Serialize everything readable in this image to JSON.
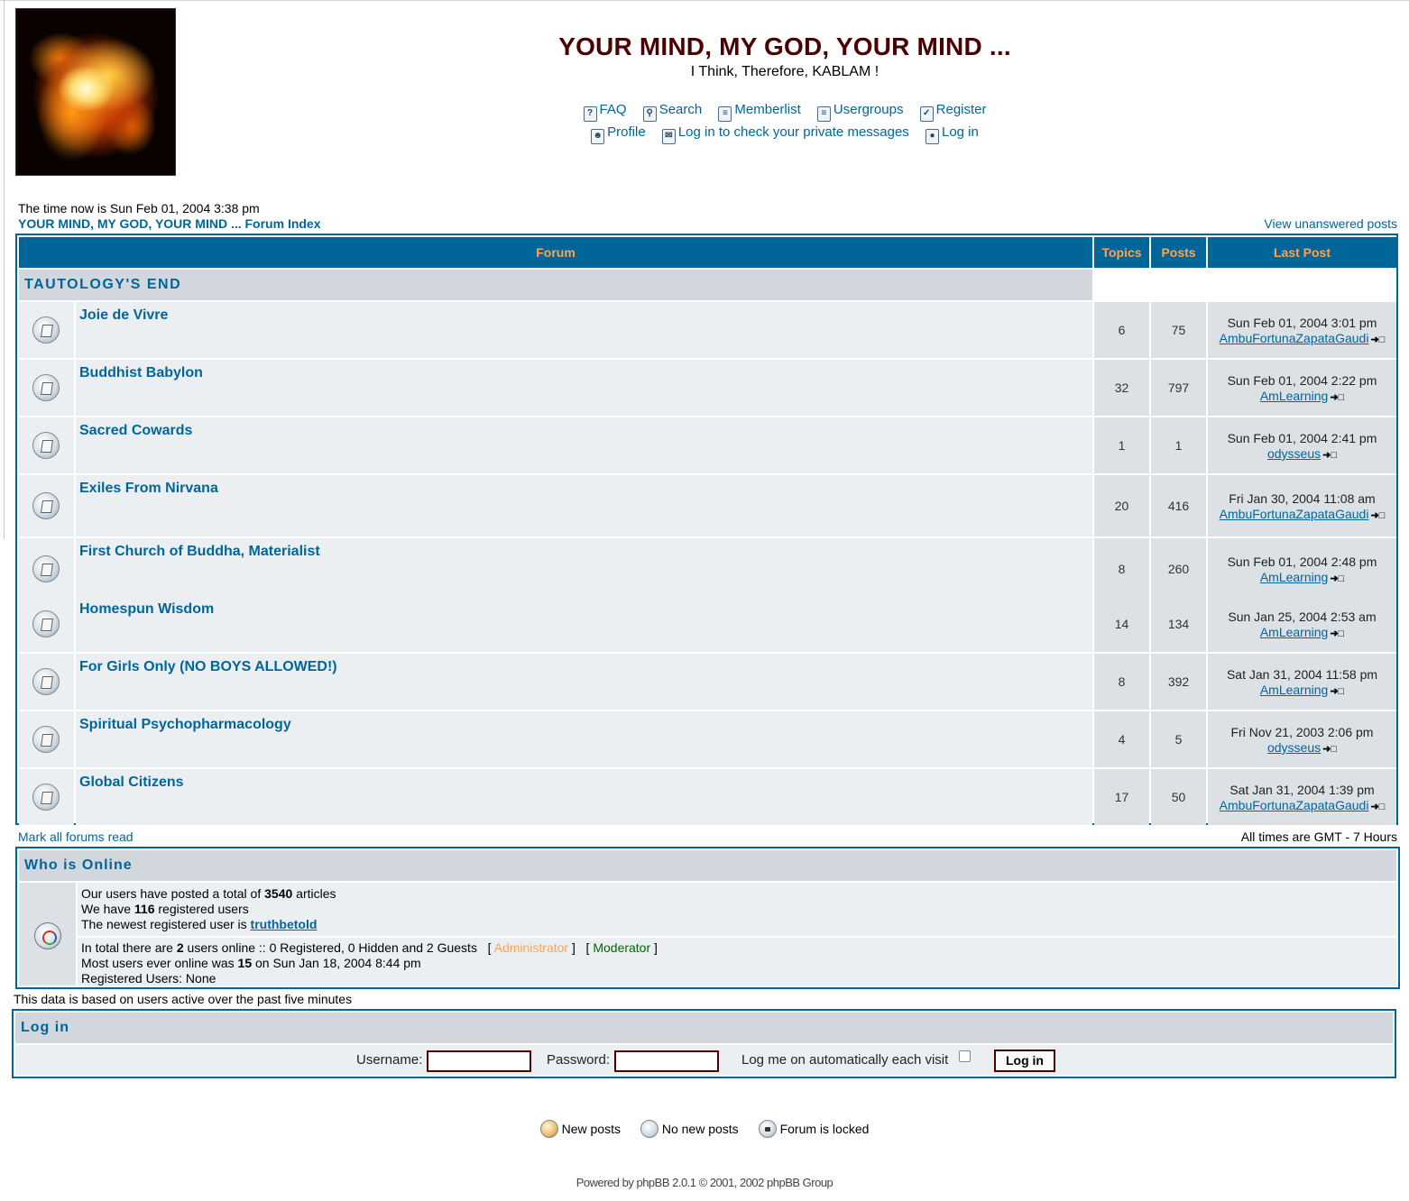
{
  "header": {
    "site_title": "YOUR MIND, MY GOD, YOUR MIND ...",
    "site_desc": "I Think, Therefore, KABLAM !",
    "nav_row1": [
      "FAQ",
      "Search",
      "Memberlist",
      "Usergroups",
      "Register"
    ],
    "nav_row2": [
      "Profile",
      "Log in to check your private messages",
      "Log in"
    ]
  },
  "info": {
    "time": "The time now is Sun Feb 01, 2004 3:38 pm",
    "breadcrumb": "YOUR MIND, MY GOD, YOUR MIND ... Forum Index",
    "unanswered": "View unanswered posts"
  },
  "table": {
    "headers": {
      "forum": "Forum",
      "topics": "Topics",
      "posts": "Posts",
      "last_post": "Last Post"
    },
    "category": "TAUTOLOGY'S END",
    "forums": [
      {
        "name": "Joie de Vivre",
        "topics": "6",
        "posts": "75",
        "last_date": "Sun Feb 01, 2004 3:01 pm",
        "last_user": "AmbuFortunaZapataGaudi"
      },
      {
        "name": "Buddhist Babylon",
        "topics": "32",
        "posts": "797",
        "last_date": "Sun Feb 01, 2004 2:22 pm",
        "last_user": "AmLearning"
      },
      {
        "name": "Sacred Cowards",
        "topics": "1",
        "posts": "1",
        "last_date": "Sun Feb 01, 2004 2:41 pm",
        "last_user": "odysseus"
      },
      {
        "name": "Exiles From Nirvana",
        "topics": "20",
        "posts": "416",
        "last_date": "Fri Jan 30, 2004 11:08 am",
        "last_user": "AmbuFortunaZapataGaudi"
      },
      {
        "name": "First Church of Buddha, Materialist",
        "topics": "8",
        "posts": "260",
        "last_date": "Sun Feb 01, 2004 2:48 pm",
        "last_user": "AmLearning"
      },
      {
        "name": "Homespun Wisdom",
        "topics": "14",
        "posts": "134",
        "last_date": "Sun Jan 25, 2004 2:53 am",
        "last_user": "AmLearning"
      },
      {
        "name": "For Girls Only (NO BOYS ALLOWED!)",
        "topics": "8",
        "posts": "392",
        "last_date": "Sat Jan 31, 2004 11:58 pm",
        "last_user": "AmLearning"
      },
      {
        "name": "Spiritual Psychopharmacology",
        "topics": "4",
        "posts": "5",
        "last_date": "Fri Nov 21, 2003 2:06 pm",
        "last_user": "odysseus"
      },
      {
        "name": "Global Citizens",
        "topics": "17",
        "posts": "50",
        "last_date": "Sat Jan 31, 2004 1:39 pm",
        "last_user": "AmbuFortunaZapataGaudi"
      }
    ]
  },
  "below_table": {
    "mark_read": "Mark all forums read",
    "timezone": "All times are GMT - 7 Hours"
  },
  "who_online": {
    "title": "Who is Online",
    "posted_pre": "Our users have posted a total of ",
    "posted_count": "3540",
    "posted_post": " articles",
    "registered_pre": "We have ",
    "registered_count": "116",
    "registered_post": " registered users",
    "newest_pre": "The newest registered user is ",
    "newest_user": "truthbetold",
    "total_pre": "In total there are ",
    "total_count": "2",
    "total_post": " users online :: 0 Registered, 0 Hidden and 2 Guests   [ ",
    "admin": "Administrator",
    "mid": " ]   [ ",
    "moderator": "Moderator",
    "end": " ]",
    "most_pre": "Most users ever online was ",
    "most_count": "15",
    "most_post": " on Sun Jan 18, 2004 8:44 pm",
    "registered_users": "Registered Users: None",
    "based_on": "This data is based on users active over the past five minutes"
  },
  "login": {
    "title": "Log in",
    "username_label": "Username:",
    "password_label": "Password:",
    "auto_label": "Log me on automatically each visit",
    "button": "Log in"
  },
  "legend": {
    "new_posts": "New posts",
    "no_new_posts": "No new posts",
    "locked": "Forum is locked"
  },
  "footer": {
    "powered": "Powered by phpBB 2.0.1 © 2001, 2002 phpBB Group"
  }
}
